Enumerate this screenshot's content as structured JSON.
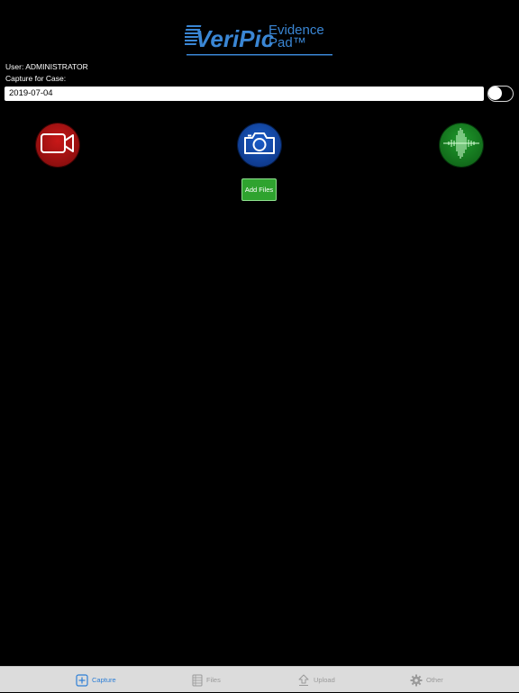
{
  "logo": {
    "brand": "VeriPic",
    "line1": "Evidence",
    "line2": "Pad™",
    "accent": "#3a86d4"
  },
  "user": {
    "text": "User: ADMINISTRATOR"
  },
  "case": {
    "label": "Capture for Case:",
    "value": "2019-07-04"
  },
  "toggle": {
    "on": false
  },
  "capture_buttons": [
    {
      "name": "video",
      "icon": "video-camera-icon",
      "color": "#b01616"
    },
    {
      "name": "photo",
      "icon": "camera-icon",
      "color": "#1a4fb0"
    },
    {
      "name": "audio",
      "icon": "audio-waveform-icon",
      "color": "#1c8a28"
    }
  ],
  "add_files": {
    "label": "Add Files",
    "color": "#2fa32f"
  },
  "tabbar": {
    "active_color": "#2e7fd6",
    "inactive_color": "#9a9a9a",
    "tabs": [
      {
        "label": "Capture",
        "icon": "capture-plus-icon",
        "active": true
      },
      {
        "label": "Files",
        "icon": "files-grid-icon",
        "active": false
      },
      {
        "label": "Upload",
        "icon": "upload-icon",
        "active": false
      },
      {
        "label": "Other",
        "icon": "gear-icon",
        "active": false
      }
    ]
  }
}
